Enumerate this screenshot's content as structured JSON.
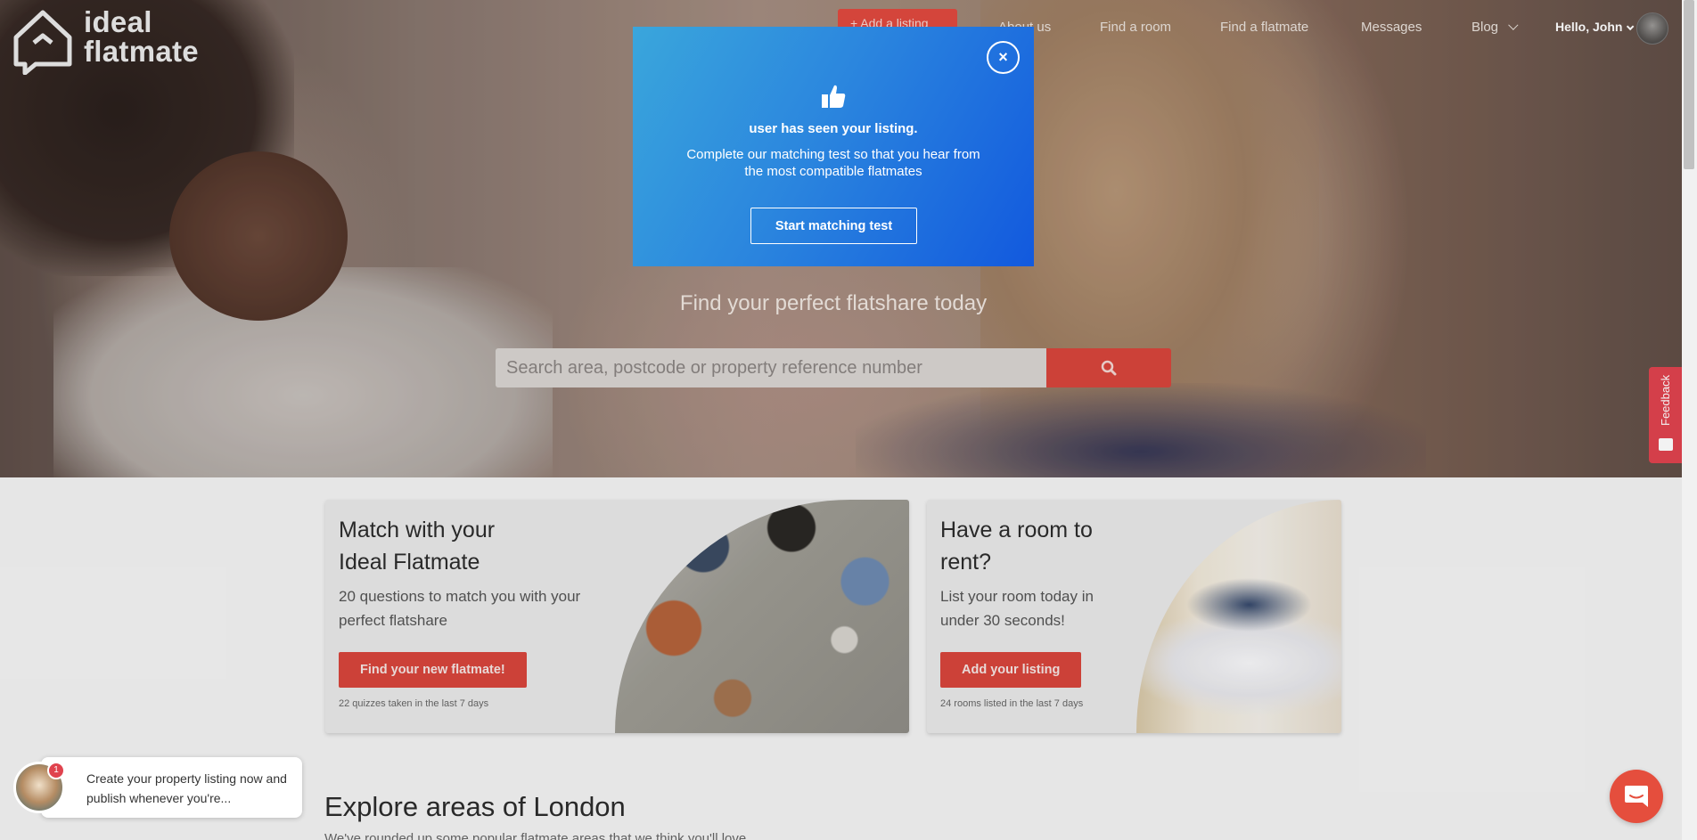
{
  "brand": {
    "line1": "ideal",
    "line2": "flatmate"
  },
  "nav": {
    "add_listing": "+ Add a listing",
    "about": "About us",
    "find_room": "Find a room",
    "find_flatmate": "Find a flatmate",
    "messages": "Messages",
    "blog": "Blog",
    "user_greeting": "Hello, John"
  },
  "hero": {
    "tagline": "Find your perfect flatshare today",
    "search_placeholder": "Search area, postcode or property reference number"
  },
  "modal": {
    "close": "×",
    "heading": "user has seen your listing.",
    "body": "Complete our matching test so that you hear from the most compatible flatmates",
    "button": "Start matching test"
  },
  "cards": [
    {
      "title_line1": "Match with your",
      "title_line2": "Ideal Flatmate",
      "desc_line1": "20 questions to match you with your",
      "desc_line2": "perfect flatshare",
      "button": "Find your new flatmate!",
      "note": "22 quizzes taken in the last 7 days"
    },
    {
      "title_line1": "Have a room to",
      "title_line2": "rent?",
      "desc_line1": "List your room today in",
      "desc_line2": "under 30 seconds!",
      "button": "Add your listing",
      "note": "24 rooms listed in the last 7 days"
    }
  ],
  "explore": {
    "title": "Explore areas of London",
    "subtitle": "We've rounded up some popular flatmate areas that we think you'll love"
  },
  "feedback": {
    "label": "Feedback"
  },
  "chat": {
    "message_line1": "Create your property listing now and",
    "message_line2": "publish whenever you're...",
    "badge": "1"
  },
  "colors": {
    "accent": "#d7453b",
    "modal_start": "#3aa6dc",
    "modal_end": "#1259de"
  }
}
